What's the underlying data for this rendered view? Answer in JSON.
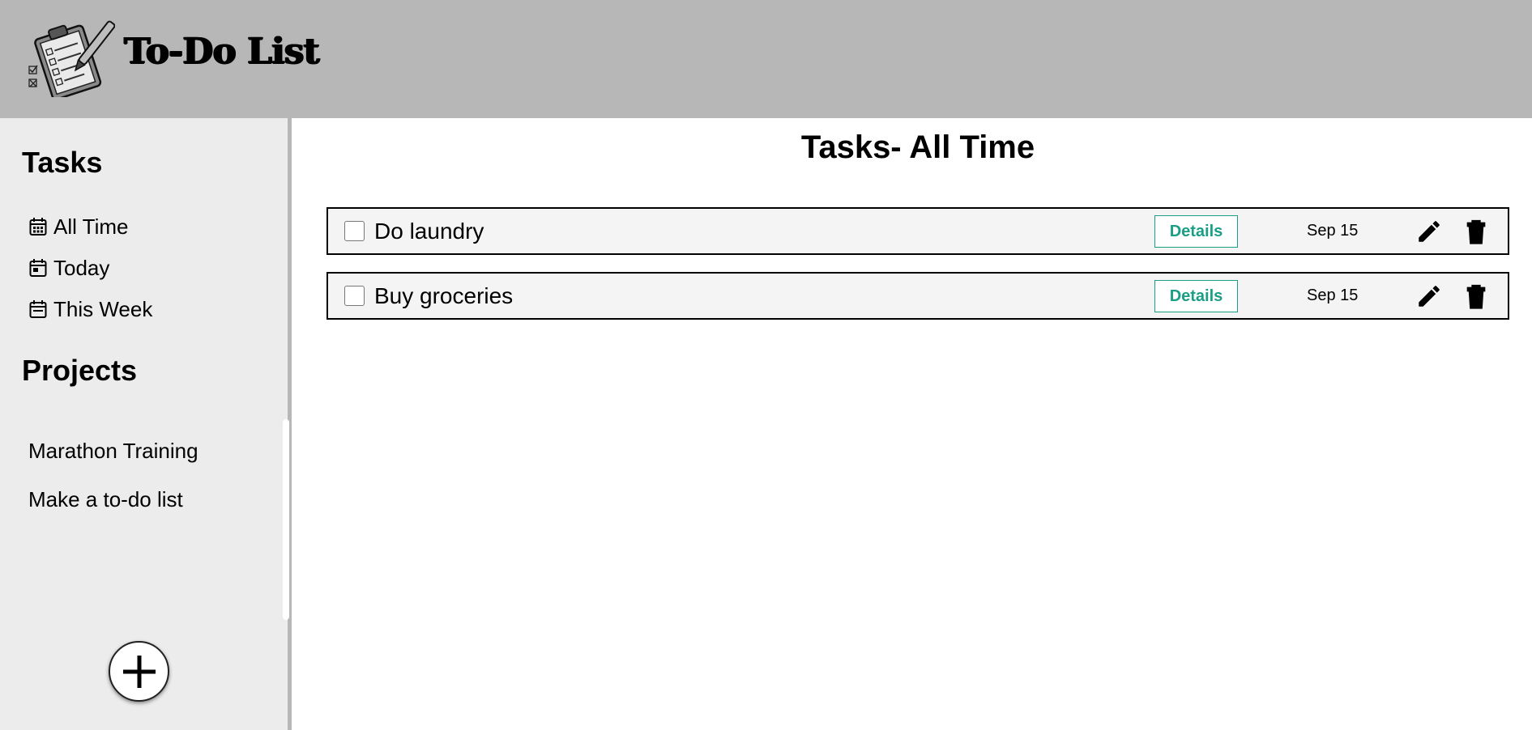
{
  "header": {
    "app_title": "To-Do List",
    "logo_icon": "clipboard-checklist-icon"
  },
  "sidebar": {
    "tasks_heading": "Tasks",
    "task_filters": [
      {
        "label": "All Time",
        "icon": "calendar-grid-icon"
      },
      {
        "label": "Today",
        "icon": "calendar-day-icon"
      },
      {
        "label": "This Week",
        "icon": "calendar-week-icon"
      }
    ],
    "projects_heading": "Projects",
    "projects": [
      {
        "label": "Marathon Training"
      },
      {
        "label": "Make a to-do list"
      }
    ],
    "add_icon": "plus-icon"
  },
  "main": {
    "page_title": "Tasks- All Time",
    "tasks": [
      {
        "title": "Do laundry",
        "details_label": "Details",
        "date": "Sep 15",
        "checked": false
      },
      {
        "title": "Buy groceries",
        "details_label": "Details",
        "date": "Sep 15",
        "checked": false
      }
    ]
  },
  "colors": {
    "header_bg": "#b7b7b7",
    "sidebar_bg": "#ececec",
    "accent": "#1a9e86",
    "task_row_bg": "#f4f4f4"
  }
}
